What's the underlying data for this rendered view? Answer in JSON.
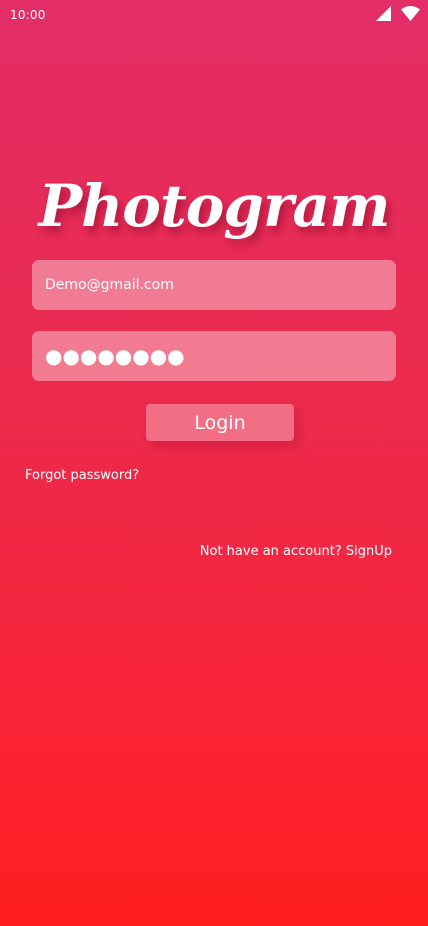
{
  "status_bar": {
    "time": "10:00",
    "icons": [
      "cellular-signal-icon",
      "wifi-icon"
    ]
  },
  "brand": {
    "title": "Photogram"
  },
  "login_form": {
    "email_value": "Demo@gmail.com",
    "password_masked": "●●●●●●●●",
    "login_label": "Login"
  },
  "links": {
    "forgot_password": "Forgot password?",
    "signup": "Not have an account? SignUp"
  },
  "colors": {
    "gradient_top": "#e22d67",
    "gradient_bottom": "#ff1e1e",
    "text": "#ffffff"
  }
}
